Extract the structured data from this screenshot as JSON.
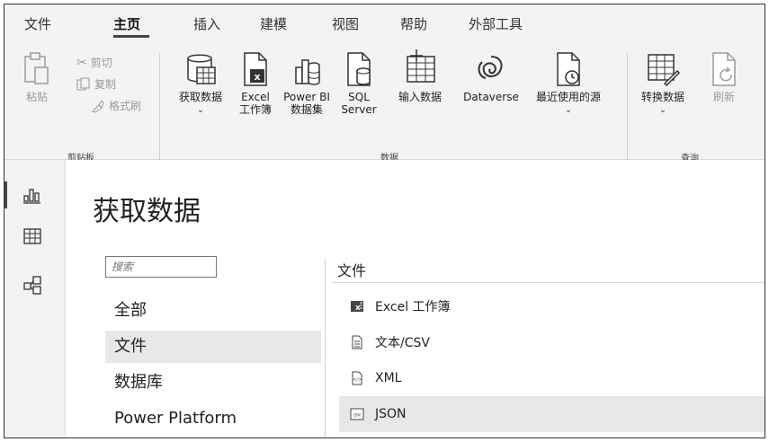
{
  "tabs": [
    {
      "label": "文件"
    },
    {
      "label": "主页"
    },
    {
      "label": "插入"
    },
    {
      "label": "建模"
    },
    {
      "label": "视图"
    },
    {
      "label": "帮助"
    },
    {
      "label": "外部工具"
    }
  ],
  "active_tab": "主页",
  "ribbon": {
    "clipboard": {
      "paste": "粘贴",
      "cut": "剪切",
      "copy": "复制",
      "format_painter": "格式刷",
      "group_label": "剪贴板"
    },
    "data": {
      "get_data_line1": "获取数据",
      "get_data_chevron": "⌄",
      "excel_line1": "Excel",
      "excel_line2": "工作簿",
      "pbi_line1": "Power BI",
      "pbi_line2": "数据集",
      "sql_line1": "SQL",
      "sql_line2": "Server",
      "enter_data": "输入数据",
      "dataverse": "Dataverse",
      "recent_line1": "最近使用的源",
      "recent_chevron": "⌄",
      "group_label": "数据"
    },
    "query": {
      "transform_line1": "转换数据",
      "transform_chevron": "⌄",
      "refresh": "刷新",
      "group_label": "查询"
    }
  },
  "rail": {
    "items": [
      "report-icon",
      "table-icon",
      "model-icon"
    ]
  },
  "main": {
    "title": "获取数据",
    "search_placeholder": "搜索",
    "categories": [
      "全部",
      "文件",
      "数据库",
      "Power Platform"
    ],
    "selected_category": "文件",
    "list_header": "文件",
    "sources": [
      {
        "label": "Excel 工作簿",
        "icon": "excel-icon"
      },
      {
        "label": "文本/CSV",
        "icon": "text-file-icon"
      },
      {
        "label": "XML",
        "icon": "xml-icon"
      },
      {
        "label": "JSON",
        "icon": "json-icon"
      }
    ],
    "selected_source": "JSON"
  }
}
